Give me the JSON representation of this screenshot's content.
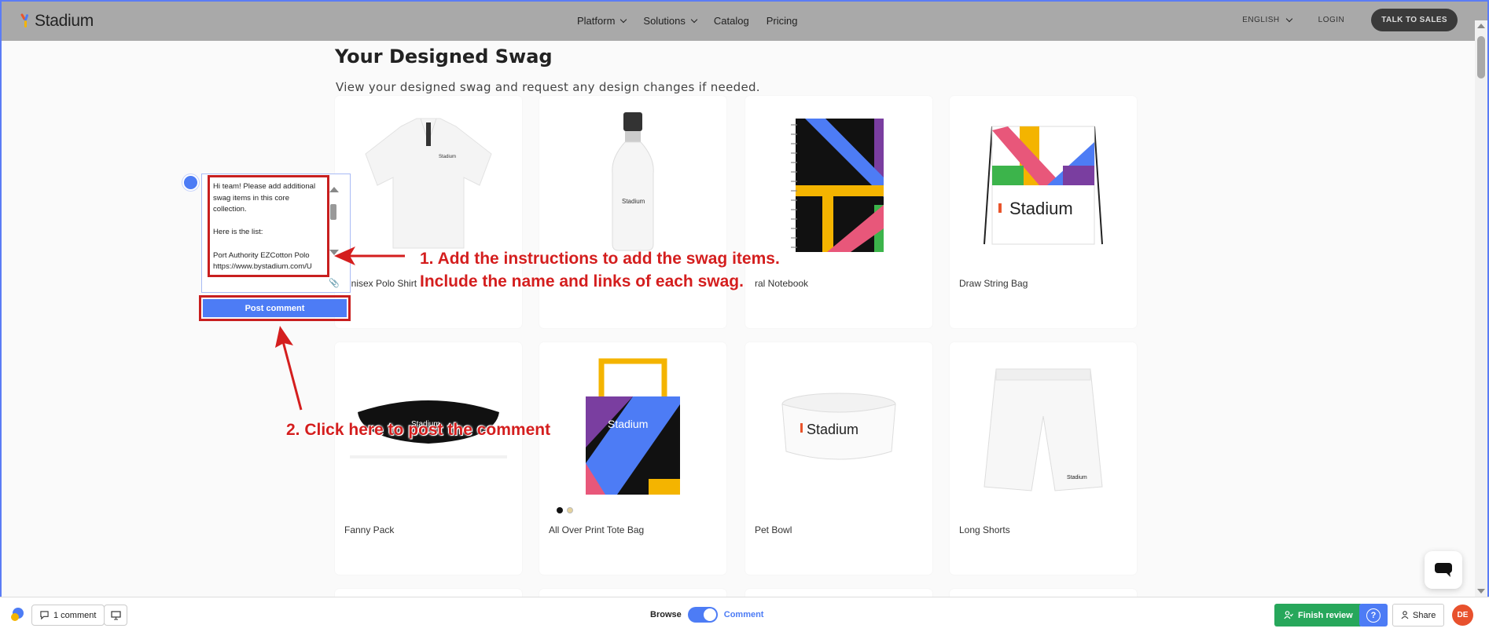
{
  "nav": {
    "brand": "Stadium",
    "items": [
      "Platform",
      "Solutions",
      "Catalog",
      "Pricing"
    ],
    "language": "ENGLISH",
    "login": "LOGIN",
    "cta": "TALK TO SALES"
  },
  "page": {
    "title": "Your Designed Swag",
    "subtitle": "View your designed swag and request any design changes if needed."
  },
  "products": [
    {
      "name": "Unisex Polo Shirt"
    },
    {
      "name": ""
    },
    {
      "name": "ral Notebook"
    },
    {
      "name": "Draw String Bag"
    },
    {
      "name": "Fanny Pack"
    },
    {
      "name": "All Over Print Tote Bag"
    },
    {
      "name": "Pet Bowl"
    },
    {
      "name": "Long Shorts"
    }
  ],
  "comment": {
    "text": "Hi team! Please add additional swag items in this core collection.\n\nHere is the list:\n\nPort Authority EZCotton Polo\nhttps://www.bystadium.com/U",
    "post_label": "Post comment"
  },
  "annotations": {
    "step1_line1": "1. Add the instructions to add the swag items.",
    "step1_line2": "Include the name and links of each swag.",
    "step2": "2. Click here to post the comment"
  },
  "toolbar": {
    "comments_count": "1 comment",
    "browse": "Browse",
    "comment_mode": "Comment",
    "finish": "Finish review",
    "share": "Share",
    "avatar_initials": "DE"
  },
  "colors": {
    "accent": "#4d7cf5",
    "annotation": "#d41e1e",
    "finish": "#27a75b",
    "avatar": "#e8512d"
  }
}
